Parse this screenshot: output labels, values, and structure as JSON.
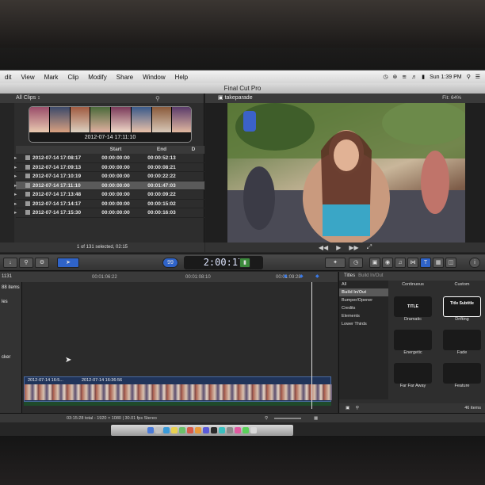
{
  "menubar": {
    "items": [
      "dit",
      "View",
      "Mark",
      "Clip",
      "Modify",
      "Share",
      "Window",
      "Help"
    ],
    "clock": "Sun 1:39 PM"
  },
  "window": {
    "title": "Final Cut Pro"
  },
  "browser": {
    "scope": "All Clips ↕",
    "filmstrip_date": "2012-07-14 17:11:10",
    "columns": [
      "",
      "Start",
      "End",
      "D"
    ],
    "rows": [
      {
        "name": "2012-07-14 17:08:17",
        "start": "00:00:00:00",
        "end": "00:00:52:13"
      },
      {
        "name": "2012-07-14 17:09:13",
        "start": "00:00:00:00",
        "end": "00:00:08:21"
      },
      {
        "name": "2012-07-14 17:10:19",
        "start": "00:00:00:00",
        "end": "00:00:22:22"
      },
      {
        "name": "2012-07-14 17:11:10",
        "start": "00:00:00:00",
        "end": "00:01:47:03"
      },
      {
        "name": "2012-07-14 17:13:48",
        "start": "00:00:00:00",
        "end": "00:00:09:22"
      },
      {
        "name": "2012-07-14 17:14:17",
        "start": "00:00:00:00",
        "end": "00:00:15:02"
      },
      {
        "name": "2012-07-14 17:15:30",
        "start": "00:00:00:00",
        "end": "00:00:16:03"
      }
    ],
    "selected_row": 3,
    "footer": "1 of 131 selected, 02:15"
  },
  "viewer": {
    "project_name": "takeparade",
    "fit_label": "Fit: 64%"
  },
  "toolbar": {
    "percent_label": "99",
    "timecode": "2:00:17"
  },
  "timeline": {
    "project_code": "1131",
    "index_label": "88 items",
    "index_partial_1": "les",
    "index_partial_2": "cker",
    "ruler": [
      "00:01:06:22",
      "00:01:08:10",
      "00:01:09:28"
    ],
    "clips": [
      "2012-07-14 16:5...",
      "2012-07-14 16:36:56"
    ]
  },
  "titles": {
    "header": "Titles",
    "subheader": "Build In/Out",
    "categories": [
      "All",
      "Build In/Out",
      "Bumper/Opener",
      "Credits",
      "Elements",
      "Lower Thirds"
    ],
    "selected_category": 1,
    "tiles": [
      {
        "name": "Continuous",
        "box": ""
      },
      {
        "name": "Custom",
        "box": ""
      },
      {
        "name": "Dramatic",
        "box": "TITLE"
      },
      {
        "name": "Drifting",
        "box": "Title Subtitle"
      },
      {
        "name": "Energetic",
        "box": ""
      },
      {
        "name": "Fade",
        "box": ""
      },
      {
        "name": "Far Far Away",
        "box": ""
      },
      {
        "name": "Feature",
        "box": ""
      }
    ],
    "item_count": "46 items"
  },
  "status": {
    "text": "03:15:28 total - 1920 × 1080 | 30.01 fps Stereo"
  },
  "colors": {
    "accent_blue": "#2f63c8",
    "selection_gray": "#5a5a5a",
    "timecode_text": "#dfe6ff"
  }
}
